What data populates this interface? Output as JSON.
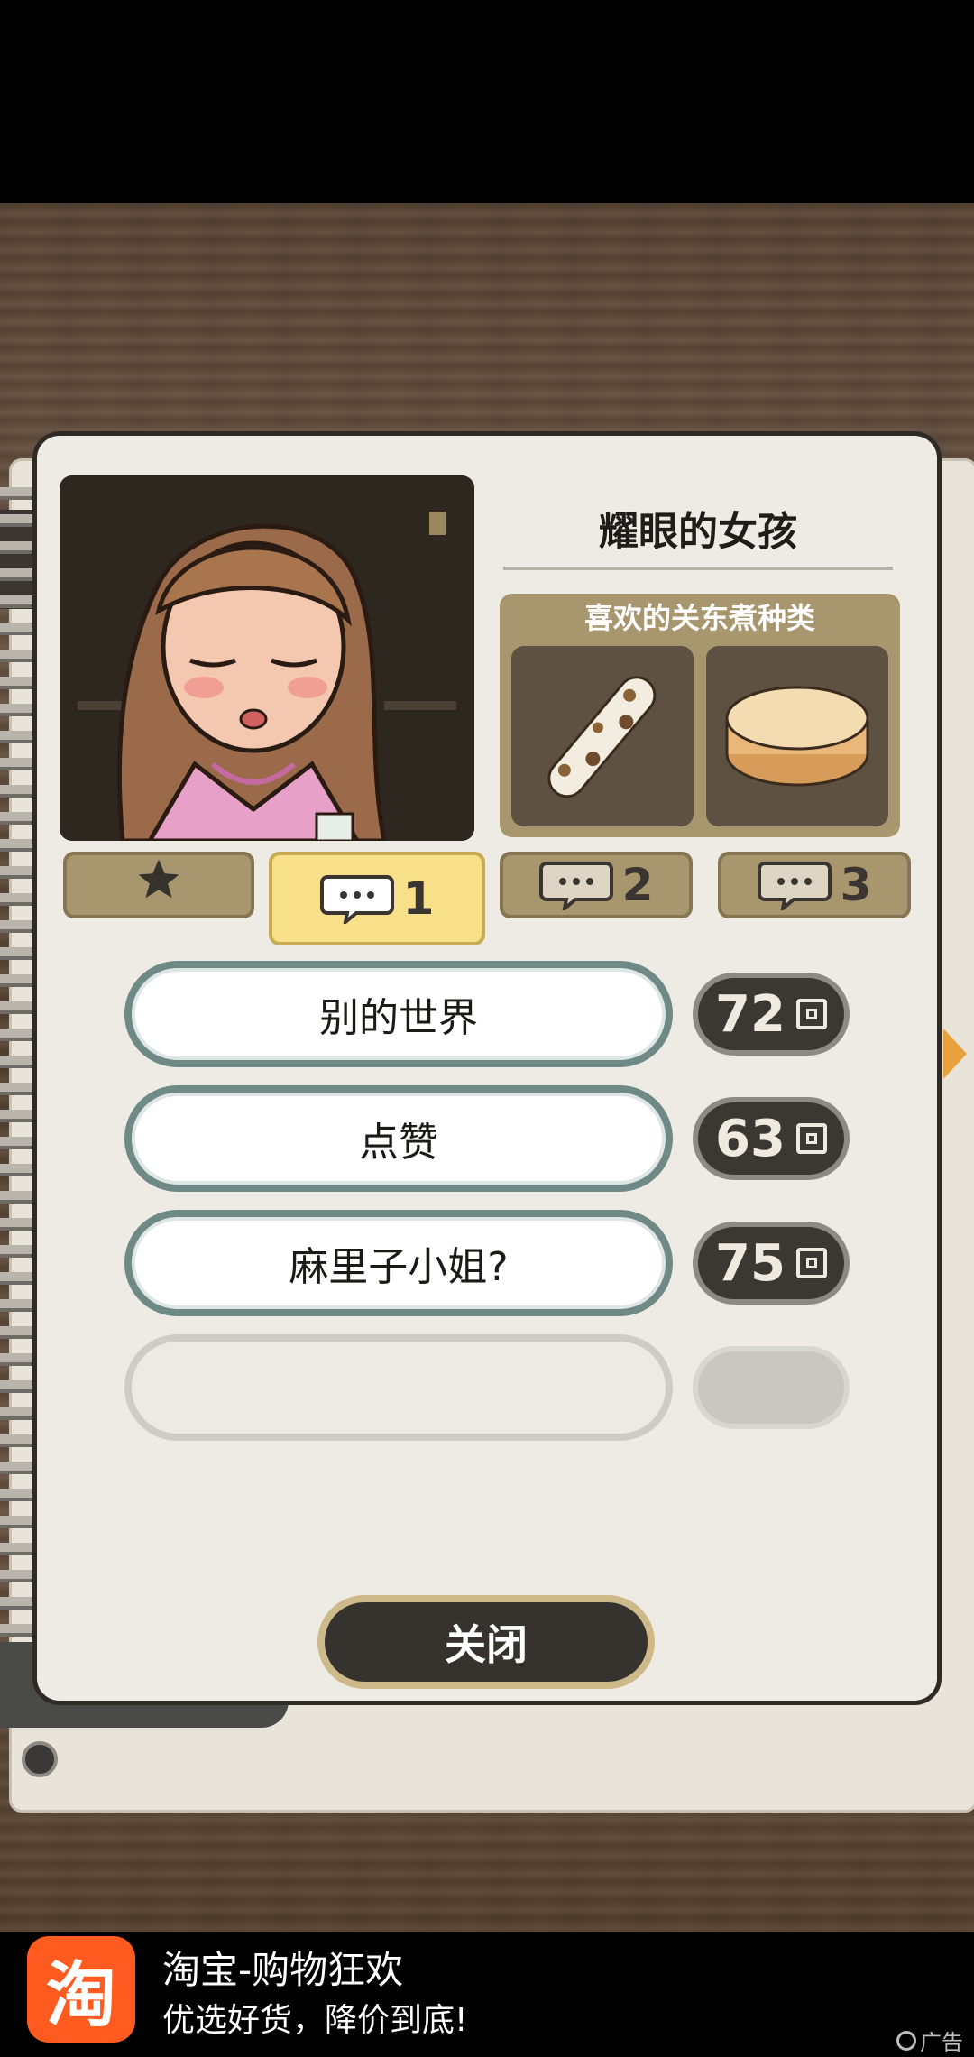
{
  "character": {
    "name": "耀眼的女孩"
  },
  "favorites": {
    "title": "喜欢的关东煮种类",
    "items": [
      "chikuwa-icon",
      "daikon-icon"
    ]
  },
  "tabs": {
    "star_icon": "star-icon",
    "items": [
      {
        "label": "1",
        "icon": "speech-bubble-icon",
        "active": true
      },
      {
        "label": "2",
        "icon": "speech-bubble-icon",
        "active": false
      },
      {
        "label": "3",
        "icon": "speech-bubble-icon",
        "active": false
      }
    ]
  },
  "topics": [
    {
      "label": "别的世界",
      "count": "72"
    },
    {
      "label": "点赞",
      "count": "63"
    },
    {
      "label": "麻里子小姐?",
      "count": "75"
    },
    {
      "label": "",
      "count": ""
    }
  ],
  "close_label": "关闭",
  "ad": {
    "logo": "淘",
    "title": "淘宝-购物狂欢",
    "subtitle": "优选好货，降价到底!",
    "tag": "广告"
  },
  "colors": {
    "panel": "#eeebe4",
    "tab_active": "#f8e08a",
    "tab": "#a8966f",
    "topic_border": "#6f8a86",
    "count_bg": "#3b3833",
    "ad_logo": "#ff5a1f"
  }
}
